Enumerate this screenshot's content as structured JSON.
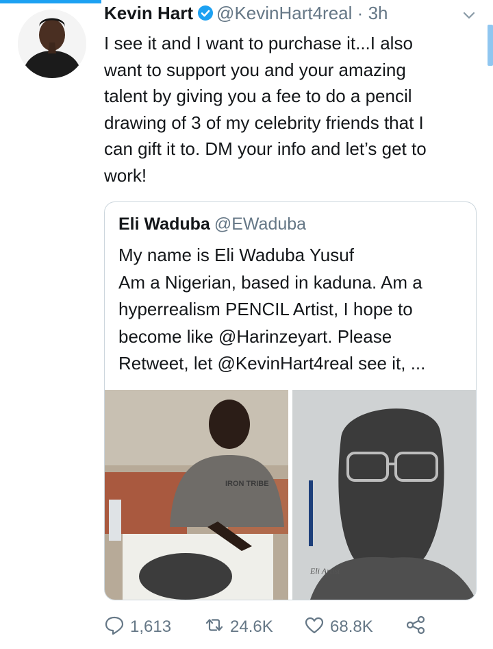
{
  "tweet": {
    "author_name": "Kevin Hart",
    "handle": "@KevinHart4real",
    "separator": "·",
    "timestamp": "3h",
    "text": "I see it and I want to purchase it...I also\nwant to support you and your amazing\ntalent by giving you a fee to do a pencil\ndrawing of 3 of my celebrity friends that I\ncan gift it to. DM your info and let’s get to\nwork!"
  },
  "quoted_tweet": {
    "author_name": "Eli Waduba",
    "handle": "@EWaduba",
    "text": "My name is Eli Waduba Yusuf\nAm a Nigerian, based in kaduna. Am a\nhyperrealism PENCIL Artist, I hope to\nbecome like @Harinzeyart. Please\nRetweet, let @KevinHart4real see it, ...",
    "images": [
      "artist-drawing-photo",
      "pencil-portrait-photo"
    ],
    "shirt_print": "IRON TRIBE",
    "signature": "Eli Artist"
  },
  "actions": {
    "replies": "1,613",
    "retweets": "24.6K",
    "likes": "68.8K"
  },
  "icons": [
    "verified-badge-icon",
    "chevron-down-icon",
    "reply-icon",
    "retweet-icon",
    "like-icon",
    "share-icon"
  ],
  "colors": {
    "accent": "#1da1f2",
    "secondary_text": "#657786",
    "border": "#ccd6dd"
  }
}
